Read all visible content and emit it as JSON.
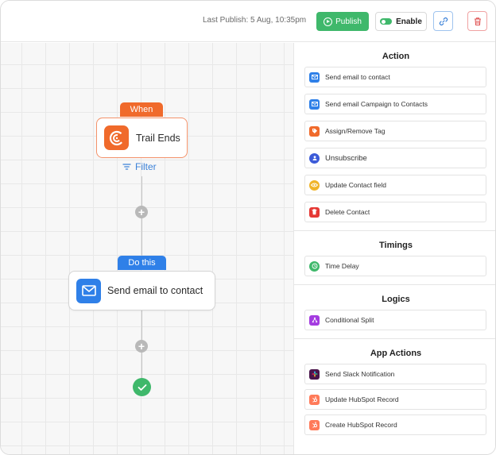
{
  "header": {
    "last_publish": "Last Publish: 5 Aug, 10:35pm",
    "publish_label": "Publish",
    "enable_label": "Enable"
  },
  "canvas": {
    "trigger_tag": "When",
    "trigger_title": "Trail Ends",
    "filter_label": "Filter",
    "action_tag": "Do this",
    "action_title": "Send email to contact"
  },
  "panel": {
    "sections": [
      {
        "title": "Action",
        "items": [
          {
            "label": "Send email to contact",
            "icon": "email-icon",
            "color": "#2f80e8"
          },
          {
            "label": "Send email Campaign to Contacts",
            "icon": "email-icon",
            "color": "#2f80e8"
          },
          {
            "label": "Assign/Remove Tag",
            "icon": "tag-icon",
            "color": "#f06a2b"
          },
          {
            "label": "Unsubscribe",
            "icon": "user-minus-icon",
            "color": "#3c5bd8"
          },
          {
            "label": "Update Contact field",
            "icon": "eye-icon",
            "color": "#f0b429"
          },
          {
            "label": "Delete Contact",
            "icon": "trash-icon",
            "color": "#e53935"
          }
        ]
      },
      {
        "title": "Timings",
        "items": [
          {
            "label": "Time Delay",
            "icon": "clock-icon",
            "color": "#3fb86b"
          }
        ]
      },
      {
        "title": "Logics",
        "items": [
          {
            "label": "Conditional Split",
            "icon": "split-icon",
            "color": "#a43ce0"
          }
        ]
      },
      {
        "title": "App Actions",
        "items": [
          {
            "label": "Send Slack Notification",
            "icon": "slack-icon",
            "color": "#4a154b"
          },
          {
            "label": "Update HubSpot Record",
            "icon": "hubspot-icon",
            "color": "#ff7a59"
          },
          {
            "label": "Create HubSpot Record",
            "icon": "hubspot-icon",
            "color": "#ff7a59"
          }
        ]
      }
    ]
  },
  "colors": {
    "accent_green": "#3fb86b",
    "accent_orange": "#f06a2b",
    "accent_blue": "#2f80e8"
  }
}
